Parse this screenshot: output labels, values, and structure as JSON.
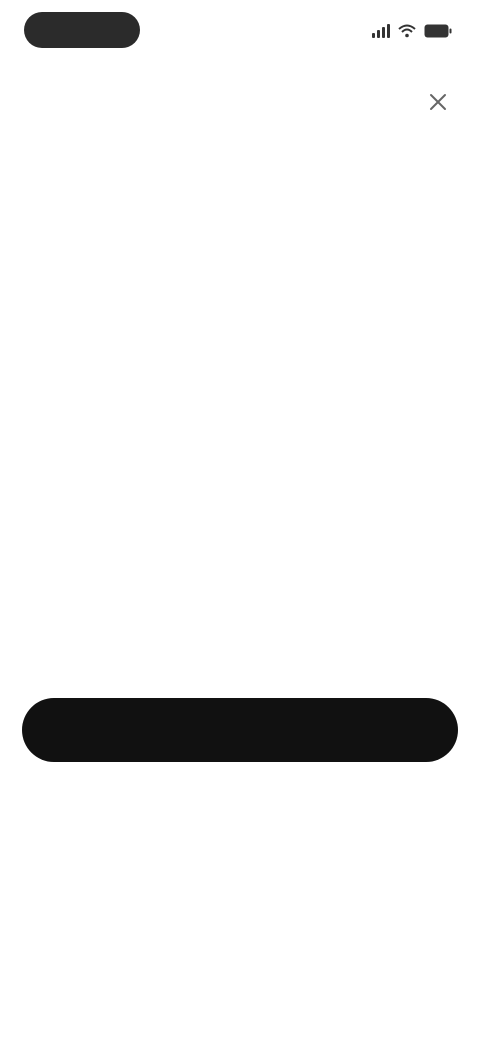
{
  "status_bar": {
    "time": "",
    "battery_percent": null
  },
  "header": {
    "close_icon": "close-icon"
  },
  "content": {
    "title_part1": "",
    "title_part2": "",
    "link1": "",
    "link2": ""
  },
  "actions": {
    "primary_label": ""
  },
  "colors": {
    "accent": "#5b7cf0",
    "button_bg": "#111111",
    "text": "#222222",
    "muted": "#8a8a8a"
  }
}
